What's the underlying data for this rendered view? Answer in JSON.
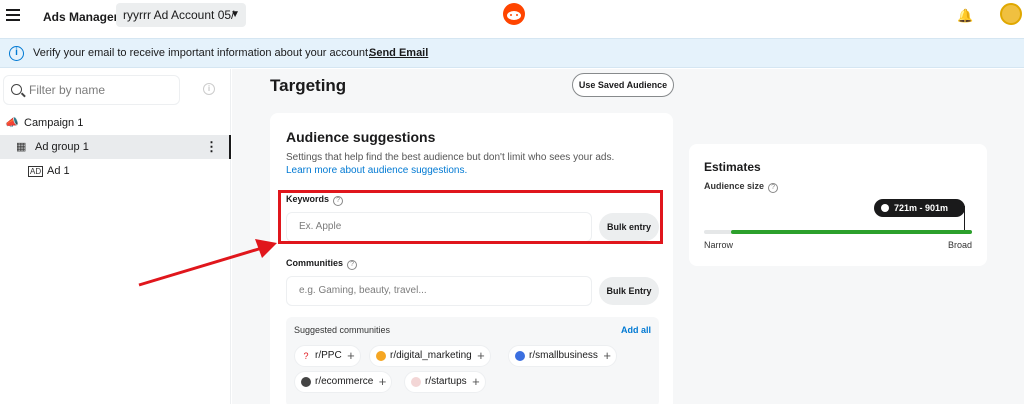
{
  "topbar": {
    "app_title": "Ads Manager",
    "account": "ryyrrr Ad Account 05/",
    "menu_icon": "hamburger-icon",
    "logo_icon": "reddit-logo",
    "notification_icon": "bell-icon"
  },
  "banner": {
    "message": "Verify your email to receive important information about your account.",
    "link": "Send Email"
  },
  "sidebar": {
    "filter_placeholder": "Filter by name",
    "items": [
      {
        "label": "Campaign 1",
        "icon": "megaphone-icon"
      },
      {
        "label": "Ad group 1",
        "icon": "grid-icon",
        "selected": true
      },
      {
        "label": "Ad 1",
        "icon": "ad-icon"
      }
    ]
  },
  "main": {
    "title": "Targeting",
    "saved_audience_button": "Use Saved Audience",
    "audience": {
      "title": "Audience suggestions",
      "description": "Settings that help find the best audience but don't limit who sees your ads.",
      "link": "Learn more about audience suggestions.",
      "keywords_label": "Keywords",
      "keywords_placeholder": "Ex. Apple",
      "keywords_bulk": "Bulk entry",
      "communities_label": "Communities",
      "communities_placeholder": "e.g. Gaming, beauty, travel...",
      "communities_bulk": "Bulk Entry",
      "suggested_title": "Suggested communities",
      "add_all": "Add all",
      "suggested": [
        "r/PPC",
        "r/digital_marketing",
        "r/smallbusiness",
        "r/ecommerce",
        "r/startups"
      ]
    },
    "estimates": {
      "title": "Estimates",
      "audience_size_label": "Audience size",
      "range": "721m - 901m",
      "min_label": "Narrow",
      "max_label": "Broad",
      "level": 0.9
    }
  },
  "colors": {
    "highlight": "#e0161c",
    "link": "#0079d3",
    "bar": "#2ca02c"
  }
}
